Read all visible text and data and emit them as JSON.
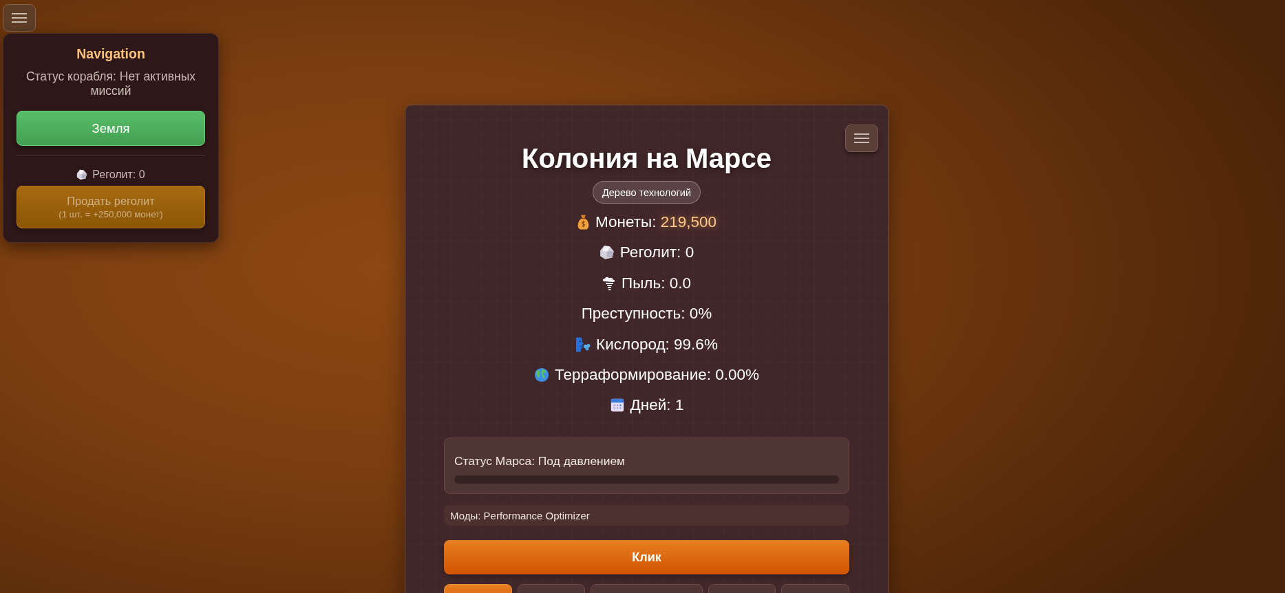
{
  "navigation": {
    "title": "Navigation",
    "ship_status": "Статус корабля: Нет активных миссий",
    "destination_button": "Земля",
    "regolith": "Реголит: 0",
    "sell_button": {
      "label": "Продать реголит",
      "note": "(1 шт. = +250,000 монет)",
      "disabled": true
    }
  },
  "colony": {
    "title": "Колония на Марсе",
    "tech_tree_button": "Дерево технологий",
    "stats": [
      {
        "kind": "coins",
        "label": "Монеты:",
        "value": "219,500"
      },
      {
        "kind": "regolith",
        "label": "Реголит:",
        "value": "0"
      },
      {
        "kind": "dust",
        "label": "Пыль:",
        "value": "0.0"
      },
      {
        "kind": "crime",
        "label": "Преступность:",
        "value": "0%"
      },
      {
        "kind": "oxygen",
        "label": "Кислород:",
        "value": "99.6%"
      },
      {
        "kind": "terraforming",
        "label": "Терраформирование:",
        "value": "0.00%"
      },
      {
        "kind": "days",
        "label": "Дней:",
        "value": "1"
      }
    ],
    "mars_status": {
      "text": "Статус Марса: Под давлением",
      "level": 0
    },
    "mods": "Моды: Performance Optimizer",
    "click_button": "Клик",
    "tabs": [
      {
        "selected": true
      },
      {
        "selected": false
      },
      {
        "selected": false
      },
      {
        "selected": false
      },
      {
        "selected": false
      }
    ]
  }
}
